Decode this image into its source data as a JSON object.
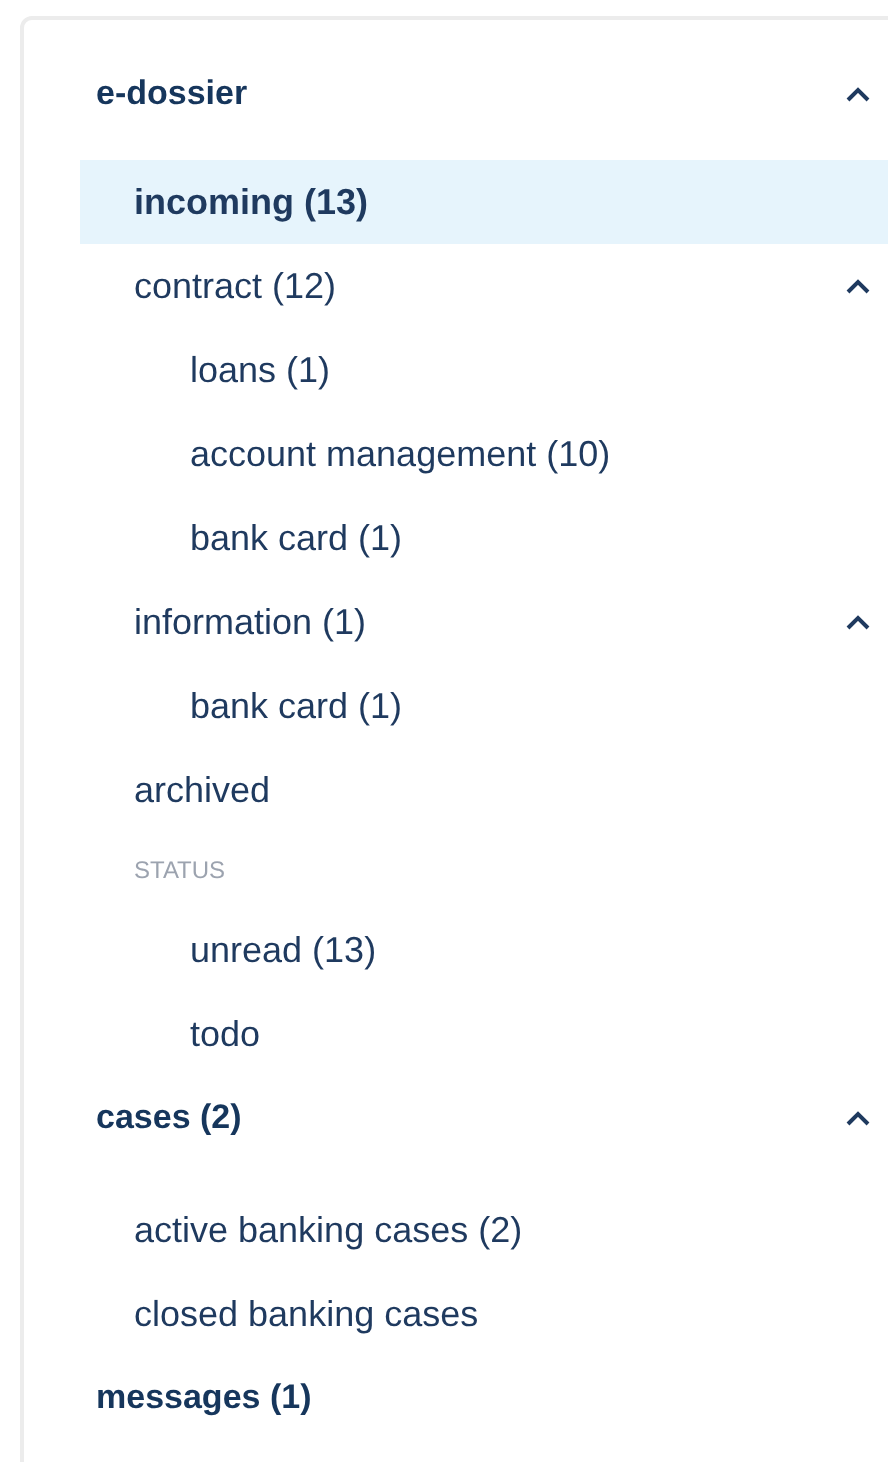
{
  "sections": [
    {
      "title": "e-dossier",
      "expanded": true,
      "items": [
        {
          "kind": "item",
          "label": "incoming (13)",
          "selected": true
        },
        {
          "kind": "item",
          "label": "contract (12)",
          "selected": false,
          "expanded": true,
          "children": [
            {
              "kind": "item",
              "label": "loans (1)",
              "selected": false
            },
            {
              "kind": "item",
              "label": "account management (10)",
              "selected": false
            },
            {
              "kind": "item",
              "label": "bank card (1)",
              "selected": false
            }
          ]
        },
        {
          "kind": "item",
          "label": "information (1)",
          "selected": false,
          "expanded": true,
          "children": [
            {
              "kind": "item",
              "label": "bank card (1)",
              "selected": false
            }
          ]
        },
        {
          "kind": "item",
          "label": "archived",
          "selected": false
        },
        {
          "kind": "label",
          "label": "STATUS",
          "children": [
            {
              "kind": "item",
              "label": "unread (13)",
              "selected": false
            },
            {
              "kind": "item",
              "label": "todo",
              "selected": false
            }
          ]
        }
      ]
    },
    {
      "title": "cases (2)",
      "expanded": true,
      "items": [
        {
          "kind": "item",
          "label": "active banking cases (2)",
          "selected": false
        },
        {
          "kind": "item",
          "label": "closed banking cases",
          "selected": false
        }
      ]
    },
    {
      "title": "messages (1)"
    }
  ]
}
